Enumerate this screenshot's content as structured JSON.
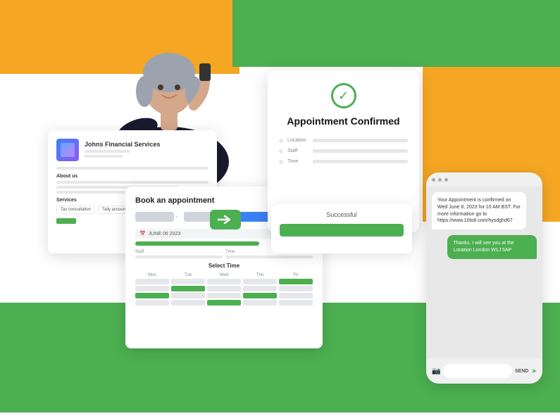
{
  "background": {
    "orange_color": "#F5A623",
    "green_color": "#4CAF50"
  },
  "person": {
    "alt": "Business woman on phone with laptop"
  },
  "financial_card": {
    "company_name": "Johns Financial Services",
    "about_label": "About us",
    "services_label": "Services",
    "btn1": "Tax consultation",
    "btn2": "Tally accounts"
  },
  "booking_card": {
    "title": "Book an appointment",
    "date": "JUNE 06 2023",
    "staff_label": "Staff",
    "time_label": "Time",
    "select_time_title": "Select Time",
    "days": [
      "Mon",
      "Tue",
      "Wed",
      "Thu",
      "Fri"
    ]
  },
  "confirmed_card": {
    "icon": "✓",
    "title": "Appointment Confirmed",
    "location_label": "Location",
    "staff_label": "Staff",
    "time_label": "Time"
  },
  "successful_card": {
    "text": "Successful"
  },
  "sms_card": {
    "message1": "Your Appointment is confirmed on Wed June 8, 2023 for 10 AM BST. For more information go to https://www.10to8.com/hysdghd67",
    "message2": "Thanks.\nI will see you at the Location London W1J 5AP",
    "send_label": "SEND"
  }
}
